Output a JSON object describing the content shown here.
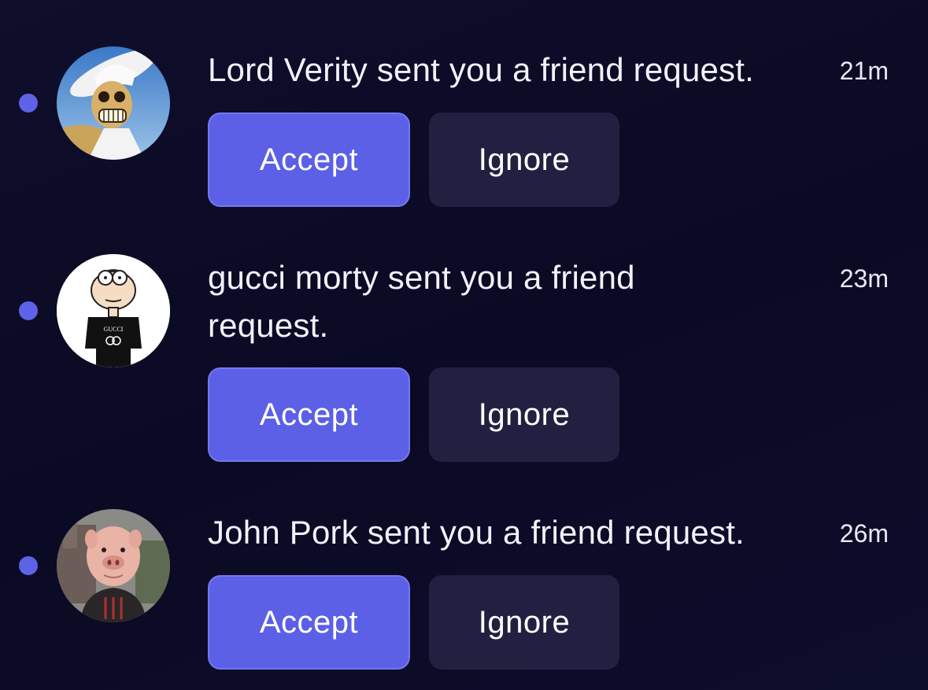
{
  "colors": {
    "background": "#0d0c28",
    "accent": "#5b60e6",
    "ignore_button": "#222040",
    "unread_dot": "#5d63e6"
  },
  "notifications": [
    {
      "unread": true,
      "avatar_icon": "skeleton-cowboy-avatar-icon",
      "message": "Lord Verity sent you a friend request.",
      "time": "21m",
      "accept_label": "Accept",
      "ignore_label": "Ignore"
    },
    {
      "unread": true,
      "avatar_icon": "cartoon-morty-avatar-icon",
      "avatar_shirt_text": "GUCCI",
      "message": "gucci morty sent you a friend request.",
      "time": "23m",
      "accept_label": "Accept",
      "ignore_label": "Ignore"
    },
    {
      "unread": true,
      "avatar_icon": "pig-face-avatar-icon",
      "message": "John Pork sent you a friend request.",
      "time": "26m",
      "accept_label": "Accept",
      "ignore_label": "Ignore"
    }
  ]
}
